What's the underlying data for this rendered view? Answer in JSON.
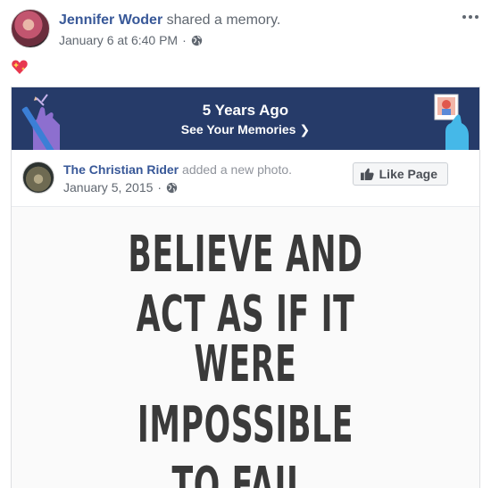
{
  "post": {
    "author_name": "Jennifer Woder",
    "action": "shared a memory.",
    "timestamp": "January 6 at 6:40 PM",
    "separator": "·",
    "privacy_icon": "globe-icon",
    "more_icon": "ellipsis-icon",
    "emoji": "sparkling-heart"
  },
  "memory": {
    "banner_title": "5 Years Ago",
    "banner_link": "See Your Memories",
    "banner_color": "#263b69"
  },
  "shared_post": {
    "page_name": "The Christian Rider",
    "action": "added a new photo.",
    "date": "January 5, 2015",
    "separator": "·",
    "like_button_label": "Like Page",
    "image_text": [
      "BELIEVE AND",
      "ACT AS IF IT WERE",
      "IMPOSSIBLE",
      "TO FAIL."
    ]
  },
  "colors": {
    "link": "#385898",
    "secondary_text": "#606770"
  }
}
